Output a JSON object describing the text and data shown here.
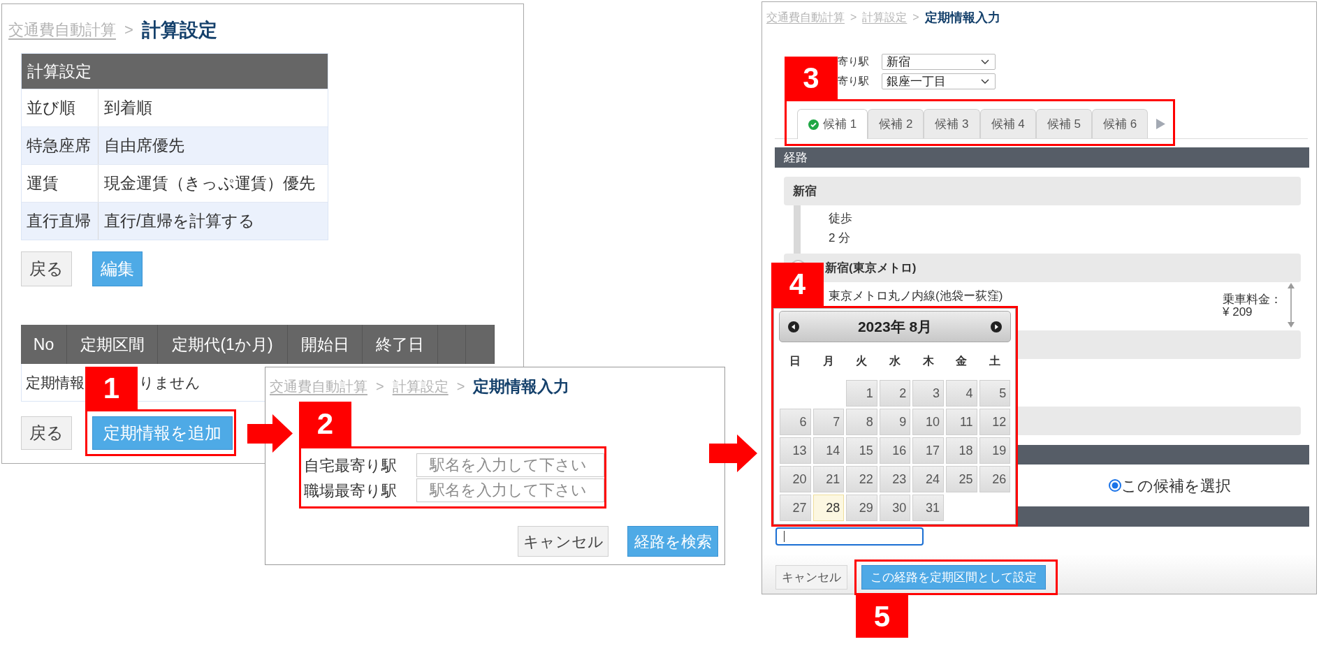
{
  "settings_page": {
    "breadcrumb": [
      {
        "kind": "link",
        "label": "交通費自動計算"
      },
      {
        "kind": "separator",
        "label": ">"
      },
      {
        "kind": "current",
        "label": "計算設定"
      }
    ],
    "settings_table": {
      "title": "計算設定",
      "rows": [
        {
          "name": "並び順",
          "value": "到着順"
        },
        {
          "name": "特急座席",
          "value": "自由席優先"
        },
        {
          "name": "運賃",
          "value": "現金運賃（きっぷ運賃）優先"
        },
        {
          "name": "直行直帰",
          "value": "直行/直帰を計算する"
        }
      ]
    },
    "settings_buttons": [
      {
        "kind": "secondary",
        "label": "戻る"
      },
      {
        "kind": "primary",
        "label": "編集"
      }
    ],
    "pass_table": {
      "columns": [
        {
          "kind": "text",
          "label": "No"
        },
        {
          "kind": "text",
          "label": "定期区間"
        },
        {
          "kind": "text",
          "label": "定期代(1か月)"
        },
        {
          "kind": "text",
          "label": "開始日"
        },
        {
          "kind": "text",
          "label": "終了日"
        },
        {
          "kind": "blank"
        },
        {
          "kind": "blank"
        }
      ],
      "empty_message_parts": [
        "定期情報",
        "りません"
      ]
    },
    "pass_buttons": [
      {
        "kind": "secondary",
        "label": "戻る"
      },
      {
        "kind": "primary",
        "label": "定期情報を追加"
      }
    ]
  },
  "station_search_page": {
    "breadcrumb": [
      {
        "kind": "link",
        "label": "交通費自動計算"
      },
      {
        "kind": "separator",
        "label": ">"
      },
      {
        "kind": "link",
        "label": "計算設定"
      },
      {
        "kind": "separator",
        "label": ">"
      },
      {
        "kind": "current",
        "label": "定期情報入力"
      }
    ],
    "fields": [
      {
        "label": "自宅最寄り駅",
        "placeholder": "駅名を入力して下さい"
      },
      {
        "label": "職場最寄り駅",
        "placeholder": "駅名を入力して下さい"
      }
    ],
    "buttons": [
      {
        "kind": "secondary",
        "label": "キャンセル"
      },
      {
        "kind": "primary",
        "label": "経路を検索"
      }
    ]
  },
  "route_page": {
    "breadcrumb": [
      {
        "kind": "link",
        "label": "交通費自動計算"
      },
      {
        "kind": "separator",
        "label": ">"
      },
      {
        "kind": "link",
        "label": "計算設定"
      },
      {
        "kind": "separator",
        "label": ">"
      },
      {
        "kind": "current",
        "label": "定期情報入力"
      }
    ],
    "station_selects": [
      {
        "label": "寄り駅",
        "value": "新宿"
      },
      {
        "label": "寄り駅",
        "value": "銀座一丁目"
      }
    ],
    "tabs": [
      {
        "label": "候補 1",
        "selected": true,
        "checked": true
      },
      {
        "label": "候補 2",
        "selected": false,
        "checked": false
      },
      {
        "label": "候補 3",
        "selected": false,
        "checked": false
      },
      {
        "label": "候補 4",
        "selected": false,
        "checked": false
      },
      {
        "label": "候補 5",
        "selected": false,
        "checked": false
      },
      {
        "label": "候補 6",
        "selected": false,
        "checked": false
      }
    ],
    "route_header": "経路",
    "route_steps": [
      {
        "kind": "station",
        "name": "新宿",
        "node": false
      },
      {
        "kind": "walk",
        "lines": [
          "徒歩",
          "2 分"
        ]
      },
      {
        "kind": "station",
        "name": "新宿(東京メトロ)",
        "node": true
      },
      {
        "kind": "ride",
        "line": "東京メトロ丸ノ内線(池袋ー荻窪)",
        "fare_label": "乗車料金：",
        "fare": "¥ 209"
      },
      {
        "kind": "station"
      },
      {
        "kind": "station"
      }
    ],
    "calendar": {
      "title": "2023年 8月",
      "weekdays": [
        "日",
        "月",
        "火",
        "水",
        "木",
        "金",
        "土"
      ],
      "days": [
        {
          "kind": "blank"
        },
        {
          "kind": "blank"
        },
        {
          "kind": "day",
          "label": "1",
          "today": false
        },
        {
          "kind": "day",
          "label": "2",
          "today": false
        },
        {
          "kind": "day",
          "label": "3",
          "today": false
        },
        {
          "kind": "day",
          "label": "4",
          "today": false
        },
        {
          "kind": "day",
          "label": "5",
          "today": false
        },
        {
          "kind": "day",
          "label": "6",
          "today": false
        },
        {
          "kind": "day",
          "label": "7",
          "today": false
        },
        {
          "kind": "day",
          "label": "8",
          "today": false
        },
        {
          "kind": "day",
          "label": "9",
          "today": false
        },
        {
          "kind": "day",
          "label": "10",
          "today": false
        },
        {
          "kind": "day",
          "label": "11",
          "today": false
        },
        {
          "kind": "day",
          "label": "12",
          "today": false
        },
        {
          "kind": "day",
          "label": "13",
          "today": false
        },
        {
          "kind": "day",
          "label": "14",
          "today": false
        },
        {
          "kind": "day",
          "label": "15",
          "today": false
        },
        {
          "kind": "day",
          "label": "16",
          "today": false
        },
        {
          "kind": "day",
          "label": "17",
          "today": false
        },
        {
          "kind": "day",
          "label": "18",
          "today": false
        },
        {
          "kind": "day",
          "label": "19",
          "today": false
        },
        {
          "kind": "day",
          "label": "20",
          "today": false
        },
        {
          "kind": "day",
          "label": "21",
          "today": false
        },
        {
          "kind": "day",
          "label": "22",
          "today": false
        },
        {
          "kind": "day",
          "label": "23",
          "today": false
        },
        {
          "kind": "day",
          "label": "24",
          "today": false
        },
        {
          "kind": "day",
          "label": "25",
          "today": false
        },
        {
          "kind": "day",
          "label": "26",
          "today": false
        },
        {
          "kind": "day",
          "label": "27",
          "today": false
        },
        {
          "kind": "day",
          "label": "28",
          "today": true
        },
        {
          "kind": "day",
          "label": "29",
          "today": false
        },
        {
          "kind": "day",
          "label": "30",
          "today": false
        },
        {
          "kind": "day",
          "label": "31",
          "today": false
        }
      ]
    },
    "candidate_choice": {
      "label": "この候補を選択",
      "selected": true
    },
    "date_input": {
      "focused": true
    },
    "buttons": [
      {
        "kind": "secondary",
        "label": "キャンセル"
      },
      {
        "kind": "primary",
        "label": "この経路を定期区間として設定"
      }
    ]
  },
  "callouts": [
    "1",
    "2",
    "3",
    "4",
    "5"
  ]
}
